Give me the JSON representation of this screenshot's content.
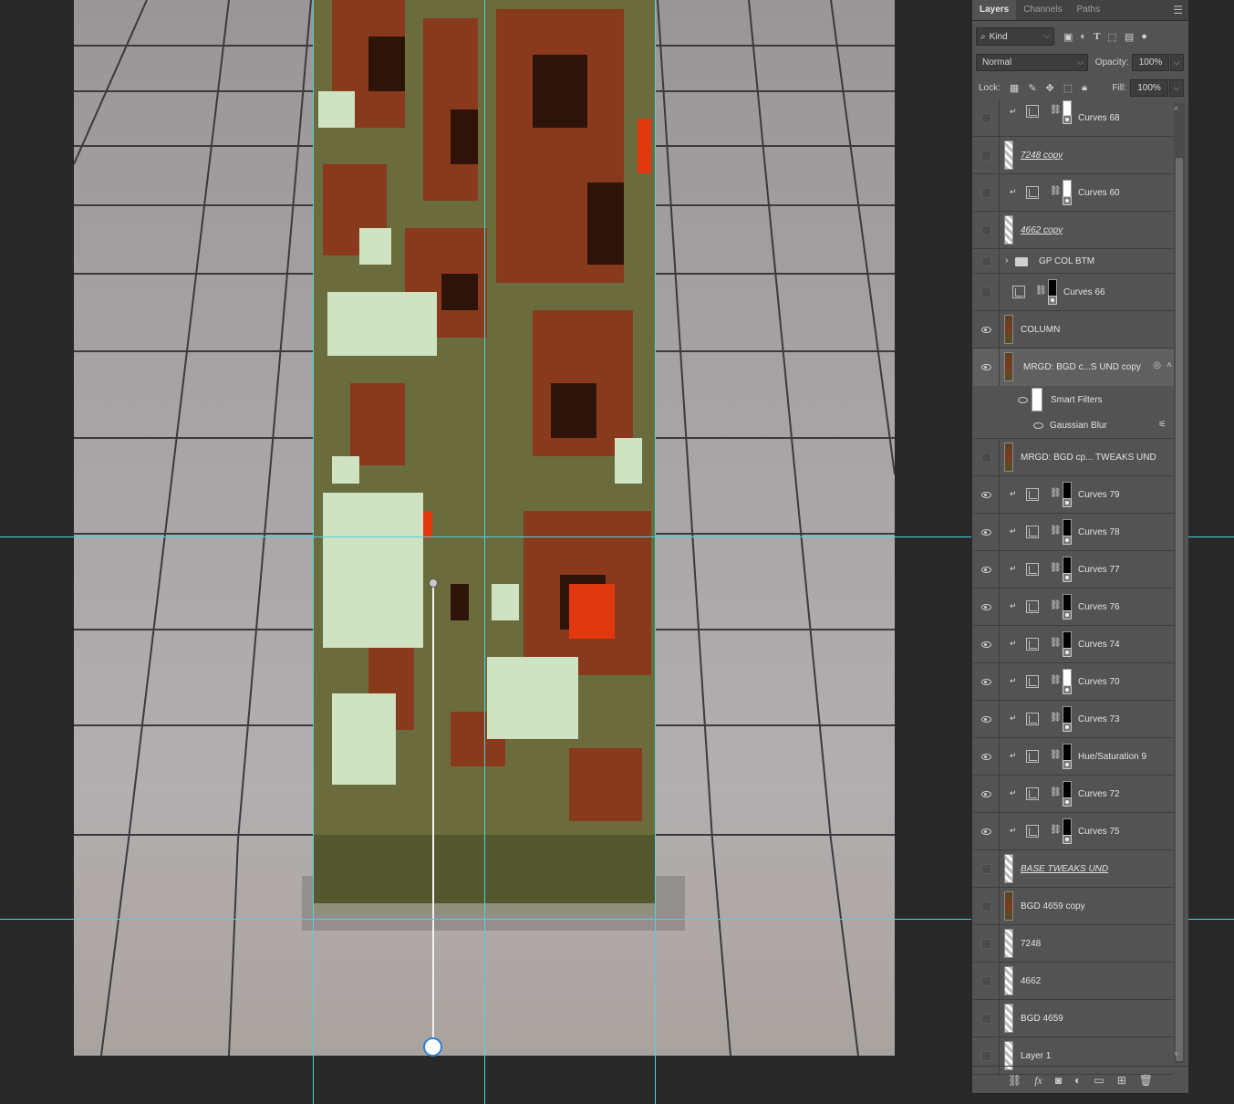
{
  "panel": {
    "tabs": [
      "Layers",
      "Channels",
      "Paths"
    ],
    "kind_label": "Kind",
    "blend_mode": "Normal",
    "opacity_label": "Opacity:",
    "opacity_value": "100%",
    "lock_label": "Lock:",
    "fill_label": "Fill:",
    "fill_value": "100%"
  },
  "layers": [
    {
      "name": "Curves 68",
      "type": "curves",
      "visible": false,
      "clipped": true,
      "mask": "white"
    },
    {
      "name": "7248 copy",
      "type": "pixel",
      "visible": false,
      "italic": true
    },
    {
      "name": "Curves 60",
      "type": "curves",
      "visible": false,
      "clipped": true,
      "mask": "white"
    },
    {
      "name": "4662 copy",
      "type": "pixel",
      "visible": false,
      "italic": true
    },
    {
      "name": "GP COL BTM",
      "type": "group",
      "visible": false
    },
    {
      "name": "Curves 66",
      "type": "curves",
      "visible": false,
      "clipped": false,
      "mask": "black"
    },
    {
      "name": "COLUMN",
      "type": "pixel",
      "visible": true
    },
    {
      "name": "MRGD: BGD c...S UND copy",
      "type": "smart",
      "visible": true,
      "selected": true
    },
    {
      "name": "Smart Filters",
      "type": "smartfilters",
      "visible": true
    },
    {
      "name": "Gaussian Blur",
      "type": "filter",
      "visible": true
    },
    {
      "name": "MRGD: BGD cp... TWEAKS UND",
      "type": "pixel",
      "visible": false
    },
    {
      "name": "Curves 79",
      "type": "curves",
      "visible": true,
      "clipped": true,
      "mask": "black"
    },
    {
      "name": "Curves 78",
      "type": "curves",
      "visible": true,
      "clipped": true,
      "mask": "black"
    },
    {
      "name": "Curves 77",
      "type": "curves",
      "visible": true,
      "clipped": true,
      "mask": "black"
    },
    {
      "name": "Curves 76",
      "type": "curves",
      "visible": true,
      "clipped": true,
      "mask": "black"
    },
    {
      "name": "Curves 74",
      "type": "curves",
      "visible": true,
      "clipped": true,
      "mask": "black"
    },
    {
      "name": "Curves 70",
      "type": "curves",
      "visible": true,
      "clipped": true,
      "mask": "white"
    },
    {
      "name": "Curves 73",
      "type": "curves",
      "visible": true,
      "clipped": true,
      "mask": "black"
    },
    {
      "name": "Hue/Saturation 9",
      "type": "huesat",
      "visible": true,
      "clipped": true,
      "mask": "black"
    },
    {
      "name": "Curves 72",
      "type": "curves",
      "visible": true,
      "clipped": true,
      "mask": "black"
    },
    {
      "name": "Curves 75",
      "type": "curves",
      "visible": true,
      "clipped": true,
      "mask": "black"
    },
    {
      "name": "BASE TWEAKS UND",
      "type": "pixel",
      "visible": false,
      "italic": true
    },
    {
      "name": "BGD 4659 copy",
      "type": "pixel",
      "visible": false
    },
    {
      "name": "7248",
      "type": "pixel",
      "visible": false
    },
    {
      "name": "4662",
      "type": "pixel",
      "visible": false
    },
    {
      "name": "BGD 4659",
      "type": "pixel",
      "visible": false
    },
    {
      "name": "Layer 1",
      "type": "pixel",
      "visible": false
    }
  ],
  "colors": {
    "guide": "#4fd2d8",
    "panel_bg": "#535353",
    "canvas_bg": "#282828"
  },
  "icons": {
    "search": "search-icon",
    "menu": "panel-menu-icon",
    "footer": [
      "link-icon",
      "fx-icon",
      "mask-icon",
      "adjustment-icon",
      "folder-icon",
      "new-layer-icon",
      "trash-icon"
    ]
  }
}
